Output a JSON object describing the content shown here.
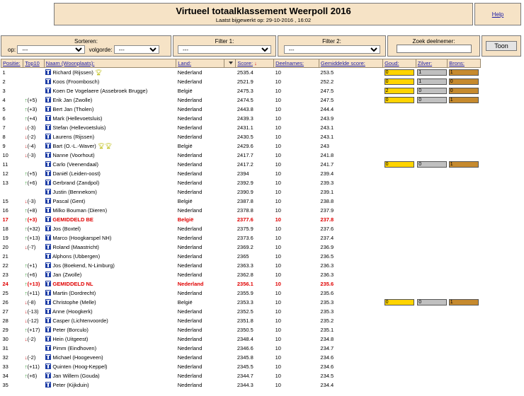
{
  "header": {
    "title": "Virtueel totaalklassement Weerpoll 2016",
    "subtitle": "Laatst bijgewerkt op: 29-10-2016 , 16:02",
    "help": "Help"
  },
  "controls": {
    "sort_title": "Sorteren:",
    "op_label": "op:",
    "op_value": "---",
    "order_label": "volgorde:",
    "order_value": "---",
    "filter1_title": "Filter 1:",
    "filter1_value": "---",
    "filter2_title": "Filter 2:",
    "filter2_value": "---",
    "search_title": "Zoek deelnemer:",
    "search_value": "",
    "toon": "Toon"
  },
  "columns": {
    "positie": "Positie:",
    "top10": "Top10",
    "naam": "Naam (Woonplaats):",
    "land": "Land:",
    "score": "Score:",
    "deelnames": "Deelnames:",
    "gemiddelde": "Gemiddelde score:",
    "goud": "Goud:",
    "zilver": "Zilver:",
    "brons": "Brons:"
  },
  "colors": {
    "panel": "#f6e3c6",
    "gold": "#ffd400",
    "silver": "#c0c0c0",
    "bronze": "#c68a2e",
    "highlight_red": "#e00000",
    "up_green": "#159015"
  },
  "rows": [
    {
      "pos": "1",
      "change": "",
      "dir": "",
      "name": "Richard (Rijssen)",
      "trophies": 1,
      "land": "Nederland",
      "score": "2535.4",
      "deelnames": "10",
      "avg": "253.5",
      "medals": [
        "0",
        "1",
        "1"
      ],
      "red": false
    },
    {
      "pos": "2",
      "change": "",
      "dir": "",
      "name": "Koos (Froombosch)",
      "trophies": 0,
      "land": "Nederland",
      "score": "2521.9",
      "deelnames": "10",
      "avg": "252.2",
      "medals": [
        "0",
        "1",
        "0"
      ],
      "red": false
    },
    {
      "pos": "3",
      "change": "",
      "dir": "",
      "name": "Koen De Vogelaere (Assebroek Brugge)",
      "trophies": 0,
      "land": "België",
      "score": "2475.3",
      "deelnames": "10",
      "avg": "247.5",
      "medals": [
        "2",
        "0",
        "0"
      ],
      "red": false
    },
    {
      "pos": "4",
      "change": "(+5)",
      "dir": "up",
      "name": "Erik Jan (Zwolle)",
      "trophies": 0,
      "land": "Nederland",
      "score": "2474.5",
      "deelnames": "10",
      "avg": "247.5",
      "medals": [
        "0",
        "0",
        "1"
      ],
      "red": false
    },
    {
      "pos": "5",
      "change": "(+3)",
      "dir": "up",
      "name": "Bert Jan (Tholen)",
      "trophies": 0,
      "land": "Nederland",
      "score": "2443.8",
      "deelnames": "10",
      "avg": "244.4",
      "medals": null,
      "red": false
    },
    {
      "pos": "6",
      "change": "(+4)",
      "dir": "up",
      "name": "Mark (Hellevoetsluis)",
      "trophies": 0,
      "land": "Nederland",
      "score": "2439.3",
      "deelnames": "10",
      "avg": "243.9",
      "medals": null,
      "red": false
    },
    {
      "pos": "7",
      "change": "(-3)",
      "dir": "down",
      "name": "Stefan (Hellevoetsluis)",
      "trophies": 0,
      "land": "Nederland",
      "score": "2431.1",
      "deelnames": "10",
      "avg": "243.1",
      "medals": null,
      "red": false
    },
    {
      "pos": "8",
      "change": "(-2)",
      "dir": "down",
      "name": "Laurens (Rijssen)",
      "trophies": 0,
      "land": "Nederland",
      "score": "2430.5",
      "deelnames": "10",
      "avg": "243.1",
      "medals": null,
      "red": false
    },
    {
      "pos": "9",
      "change": "(-4)",
      "dir": "down",
      "name": "Bart (O.-L.-Waver)",
      "trophies": 2,
      "land": "België",
      "score": "2429.6",
      "deelnames": "10",
      "avg": "243",
      "medals": null,
      "red": false
    },
    {
      "pos": "10",
      "change": "(-3)",
      "dir": "down",
      "name": "Nanne (Voorhout)",
      "trophies": 0,
      "land": "Nederland",
      "score": "2417.7",
      "deelnames": "10",
      "avg": "241.8",
      "medals": null,
      "red": false
    },
    {
      "pos": "11",
      "change": "",
      "dir": "",
      "name": "Carlo (Veenendaal)",
      "trophies": 0,
      "land": "Nederland",
      "score": "2417.2",
      "deelnames": "10",
      "avg": "241.7",
      "medals": [
        "0",
        "0",
        "1"
      ],
      "red": false
    },
    {
      "pos": "12",
      "change": "(+5)",
      "dir": "up",
      "name": "Daniël (Leiden-oost)",
      "trophies": 0,
      "land": "Nederland",
      "score": "2394",
      "deelnames": "10",
      "avg": "239.4",
      "medals": null,
      "red": false
    },
    {
      "pos": "13",
      "change": "(+6)",
      "dir": "up",
      "name": "Gerbrand (Zandpol)",
      "trophies": 0,
      "land": "Nederland",
      "score": "2392.9",
      "deelnames": "10",
      "avg": "239.3",
      "medals": null,
      "red": false
    },
    {
      "pos": "",
      "change": "",
      "dir": "",
      "name": "Justin (Bennekom)",
      "trophies": 0,
      "land": "Nederland",
      "score": "2390.9",
      "deelnames": "10",
      "avg": "239.1",
      "medals": null,
      "red": false
    },
    {
      "pos": "15",
      "change": "(-3)",
      "dir": "down",
      "name": "Pascal (Gent)",
      "trophies": 0,
      "land": "België",
      "score": "2387.8",
      "deelnames": "10",
      "avg": "238.8",
      "medals": null,
      "red": false
    },
    {
      "pos": "16",
      "change": "(+8)",
      "dir": "up",
      "name": "Milko Bouman (Dieren)",
      "trophies": 0,
      "land": "Nederland",
      "score": "2378.8",
      "deelnames": "10",
      "avg": "237.9",
      "medals": null,
      "red": false
    },
    {
      "pos": "17",
      "change": "(+3)",
      "dir": "up",
      "name": "GEMIDDELD BE",
      "trophies": 0,
      "land": "België",
      "score": "2377.6",
      "deelnames": "10",
      "avg": "237.8",
      "medals": null,
      "red": true
    },
    {
      "pos": "18",
      "change": "(+32)",
      "dir": "up",
      "name": "Jos (Boxtel)",
      "trophies": 0,
      "land": "Nederland",
      "score": "2375.9",
      "deelnames": "10",
      "avg": "237.6",
      "medals": null,
      "red": false
    },
    {
      "pos": "19",
      "change": "(+13)",
      "dir": "up",
      "name": "Marco (Hoogkarspel NH)",
      "trophies": 0,
      "land": "Nederland",
      "score": "2373.6",
      "deelnames": "10",
      "avg": "237.4",
      "medals": null,
      "red": false
    },
    {
      "pos": "20",
      "change": "(-7)",
      "dir": "down",
      "name": "Roland (Maastricht)",
      "trophies": 0,
      "land": "Nederland",
      "score": "2369.2",
      "deelnames": "10",
      "avg": "236.9",
      "medals": null,
      "red": false
    },
    {
      "pos": "21",
      "change": "",
      "dir": "",
      "name": "Alphons (Ubbergen)",
      "trophies": 0,
      "land": "Nederland",
      "score": "2365",
      "deelnames": "10",
      "avg": "236.5",
      "medals": null,
      "red": false
    },
    {
      "pos": "22",
      "change": "(+1)",
      "dir": "up",
      "name": "Jos (Boekend, N-Limburg)",
      "trophies": 0,
      "land": "Nederland",
      "score": "2363.3",
      "deelnames": "10",
      "avg": "236.3",
      "medals": null,
      "red": false
    },
    {
      "pos": "23",
      "change": "(+6)",
      "dir": "up",
      "name": "Jan (Zwolle)",
      "trophies": 0,
      "land": "Nederland",
      "score": "2362.8",
      "deelnames": "10",
      "avg": "236.3",
      "medals": null,
      "red": false
    },
    {
      "pos": "24",
      "change": "(+13)",
      "dir": "up",
      "name": "GEMIDDELD NL",
      "trophies": 0,
      "land": "Nederland",
      "score": "2356.1",
      "deelnames": "10",
      "avg": "235.6",
      "medals": null,
      "red": true
    },
    {
      "pos": "25",
      "change": "(+11)",
      "dir": "up",
      "name": "Martin (Dordrecht)",
      "trophies": 0,
      "land": "Nederland",
      "score": "2355.9",
      "deelnames": "10",
      "avg": "235.6",
      "medals": null,
      "red": false
    },
    {
      "pos": "26",
      "change": "(-8)",
      "dir": "down",
      "name": "Christophe (Melle)",
      "trophies": 0,
      "land": "België",
      "score": "2353.3",
      "deelnames": "10",
      "avg": "235.3",
      "medals": [
        "0",
        "0",
        "1"
      ],
      "red": false
    },
    {
      "pos": "27",
      "change": "(-13)",
      "dir": "down",
      "name": "Anne (Hoogkerk)",
      "trophies": 0,
      "land": "Nederland",
      "score": "2352.5",
      "deelnames": "10",
      "avg": "235.3",
      "medals": null,
      "red": false
    },
    {
      "pos": "28",
      "change": "(-12)",
      "dir": "down",
      "name": "Casper (Lichtenvoorde)",
      "trophies": 0,
      "land": "Nederland",
      "score": "2351.8",
      "deelnames": "10",
      "avg": "235.2",
      "medals": null,
      "red": false
    },
    {
      "pos": "29",
      "change": "(+17)",
      "dir": "up",
      "name": "Peter (Borculo)",
      "trophies": 0,
      "land": "Nederland",
      "score": "2350.5",
      "deelnames": "10",
      "avg": "235.1",
      "medals": null,
      "red": false
    },
    {
      "pos": "30",
      "change": "(-2)",
      "dir": "down",
      "name": "Hein (Uitgeest)",
      "trophies": 0,
      "land": "Nederland",
      "score": "2348.4",
      "deelnames": "10",
      "avg": "234.8",
      "medals": null,
      "red": false
    },
    {
      "pos": "31",
      "change": "",
      "dir": "",
      "name": "Pimm (Eindhoven)",
      "trophies": 0,
      "land": "Nederland",
      "score": "2346.6",
      "deelnames": "10",
      "avg": "234.7",
      "medals": null,
      "red": false
    },
    {
      "pos": "32",
      "change": "(-2)",
      "dir": "down",
      "name": "Michael (Hoogeveen)",
      "trophies": 0,
      "land": "Nederland",
      "score": "2345.8",
      "deelnames": "10",
      "avg": "234.6",
      "medals": null,
      "red": false
    },
    {
      "pos": "33",
      "change": "(+11)",
      "dir": "up",
      "name": "Quinten (Hoog-Keppel)",
      "trophies": 0,
      "land": "Nederland",
      "score": "2345.5",
      "deelnames": "10",
      "avg": "234.6",
      "medals": null,
      "red": false
    },
    {
      "pos": "34",
      "change": "(+6)",
      "dir": "up",
      "name": "Jan Willem (Gouda)",
      "trophies": 0,
      "land": "Nederland",
      "score": "2344.7",
      "deelnames": "10",
      "avg": "234.5",
      "medals": null,
      "red": false
    },
    {
      "pos": "35",
      "change": "",
      "dir": "",
      "name": "Peter (Kijkduin)",
      "trophies": 0,
      "land": "Nederland",
      "score": "2344.3",
      "deelnames": "10",
      "avg": "234.4",
      "medals": null,
      "red": false
    }
  ]
}
